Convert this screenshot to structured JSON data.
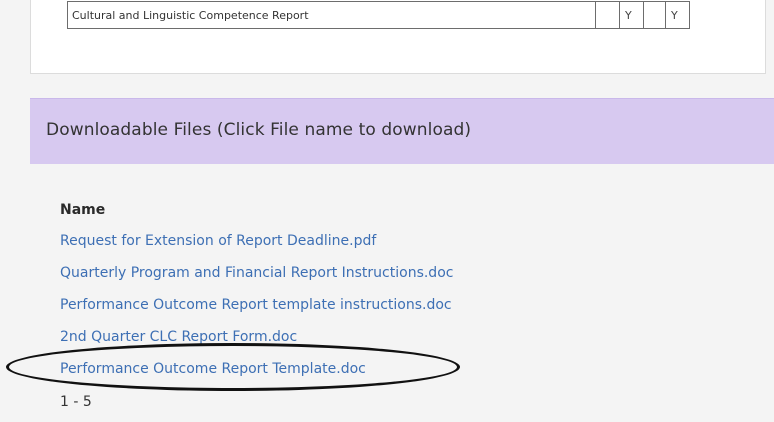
{
  "report_table": {
    "name": "Cultural and Linguistic Competence Report",
    "flags": [
      "",
      "Y",
      "",
      "Y"
    ]
  },
  "files_panel": {
    "header": "Downloadable Files (Click File name to download)",
    "column_header": "Name",
    "files": [
      "Request for Extension of Report Deadline.pdf",
      "Quarterly Program and Financial Report Instructions.doc",
      "Performance Outcome Report template instructions.doc",
      "2nd Quarter CLC Report Form.doc",
      "Performance Outcome Report Template.doc"
    ],
    "pager": "1 - 5"
  },
  "colors": {
    "header_bg": "#d7c9f0",
    "link": "#3d6fb4",
    "page_bg": "#f4f4f4"
  }
}
